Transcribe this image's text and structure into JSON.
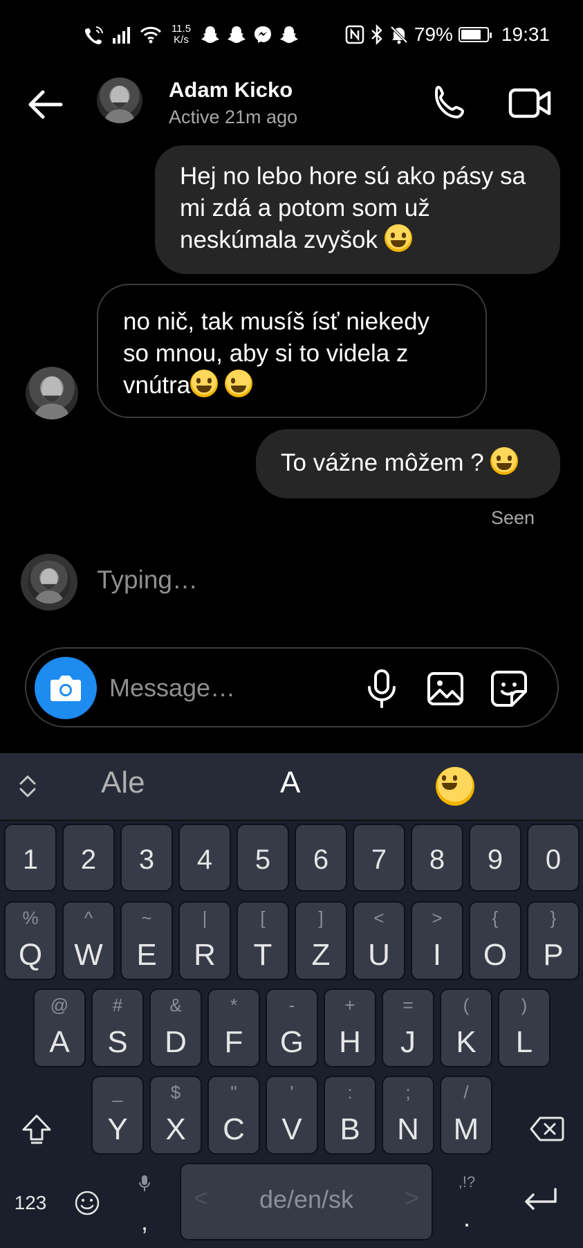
{
  "status_bar": {
    "net_speed_value": "11.5",
    "net_speed_unit": "K/s",
    "battery_percent_text": "79%",
    "battery_level": 0.79,
    "time": "19:31"
  },
  "header": {
    "contact_name": "Adam Kicko",
    "contact_status": "Active 21m ago"
  },
  "messages": [
    {
      "direction": "outgoing",
      "text": "Hej no  lebo hore sú ako pásy sa mi zdá a potom som už neskúmala zvyšok",
      "emojis": [
        "grinning-sweat"
      ]
    },
    {
      "direction": "incoming",
      "text": "no nič, tak musíš ísť niekedy so mnou, aby si to videla z vnútra",
      "emojis": [
        "grinning-sweat",
        "winking-face"
      ]
    },
    {
      "direction": "outgoing",
      "text": "To vážne môžem ? ",
      "emojis": [
        "grinning-sweat"
      ]
    }
  ],
  "seen_label": "Seen",
  "typing_label": "Typing…",
  "composer": {
    "placeholder": "Message…"
  },
  "keyboard": {
    "suggestions": [
      "Ale",
      "A"
    ],
    "suggestion_emoji": "tears-of-joy",
    "number_row": [
      "1",
      "2",
      "3",
      "4",
      "5",
      "6",
      "7",
      "8",
      "9",
      "0"
    ],
    "row1": [
      {
        "main": "Q",
        "sub": "%"
      },
      {
        "main": "W",
        "sub": "^"
      },
      {
        "main": "E",
        "sub": "~"
      },
      {
        "main": "R",
        "sub": "|"
      },
      {
        "main": "T",
        "sub": "["
      },
      {
        "main": "Z",
        "sub": "]"
      },
      {
        "main": "U",
        "sub": "<"
      },
      {
        "main": "I",
        "sub": ">"
      },
      {
        "main": "O",
        "sub": "{"
      },
      {
        "main": "P",
        "sub": "}"
      }
    ],
    "row2": [
      {
        "main": "A",
        "sub": "@"
      },
      {
        "main": "S",
        "sub": "#"
      },
      {
        "main": "D",
        "sub": "&"
      },
      {
        "main": "F",
        "sub": "*"
      },
      {
        "main": "G",
        "sub": "-"
      },
      {
        "main": "H",
        "sub": "+"
      },
      {
        "main": "J",
        "sub": "="
      },
      {
        "main": "K",
        "sub": "("
      },
      {
        "main": "L",
        "sub": ")"
      }
    ],
    "row3": [
      {
        "main": "Y",
        "sub": "_"
      },
      {
        "main": "X",
        "sub": "$"
      },
      {
        "main": "C",
        "sub": "\""
      },
      {
        "main": "V",
        "sub": "'"
      },
      {
        "main": "B",
        "sub": ":"
      },
      {
        "main": "N",
        "sub": ";"
      },
      {
        "main": "M",
        "sub": "/"
      }
    ],
    "numbers_label": "123",
    "comma_label": ",",
    "space_label": "de/en/sk",
    "space_left": "<",
    "space_right": ">",
    "punct_hint": ",!?",
    "period_label": "."
  }
}
